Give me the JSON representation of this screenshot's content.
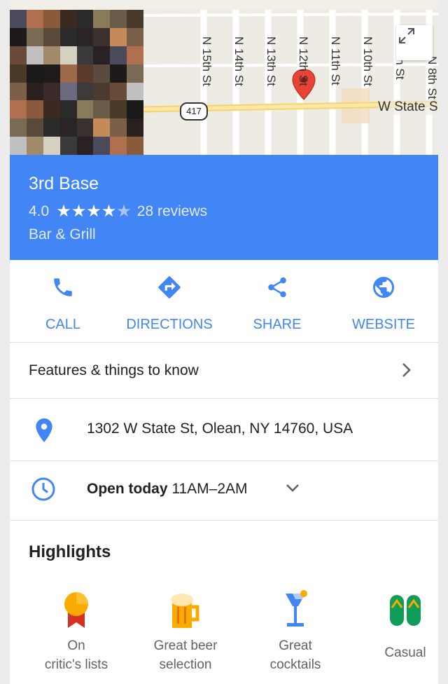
{
  "map": {
    "streets": [
      "N 15th St",
      "N 14th St",
      "N 13th St",
      "N 12th St",
      "N 11th St",
      "N 10th St",
      "N 9th St",
      "N 8th St"
    ],
    "highway_shield": "417",
    "main_road": "W State S",
    "expand_icon": "expand-icon"
  },
  "place": {
    "name": "3rd Base",
    "rating": "4.0",
    "stars_filled": 4,
    "stars_total": 5,
    "reviews": "28 reviews",
    "category": "Bar & Grill"
  },
  "actions": [
    {
      "label": "CALL",
      "icon": "phone-icon"
    },
    {
      "label": "DIRECTIONS",
      "icon": "directions-icon"
    },
    {
      "label": "SHARE",
      "icon": "share-icon"
    },
    {
      "label": "WEBSITE",
      "icon": "globe-icon"
    }
  ],
  "features": {
    "label": "Features & things to know"
  },
  "address": {
    "text": "1302 W State St, Olean, NY 14760, USA"
  },
  "hours": {
    "status": "Open today",
    "time": "11AM–2AM"
  },
  "highlights": {
    "title": "Highlights",
    "items": [
      {
        "line1": "On",
        "line2": "critic's lists",
        "icon": "medal-icon"
      },
      {
        "line1": "Great beer",
        "line2": "selection",
        "icon": "beer-mug-icon"
      },
      {
        "line1": "Great",
        "line2": "cocktails",
        "icon": "cocktail-icon"
      },
      {
        "line1": "Casual",
        "line2": "",
        "icon": "flip-flops-icon"
      }
    ]
  },
  "colors": {
    "accent": "#4285f4",
    "marker": "#ea4335"
  }
}
